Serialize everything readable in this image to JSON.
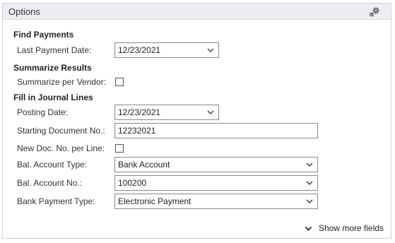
{
  "panel": {
    "title": "Options",
    "gear_icon": "gears-icon"
  },
  "sections": {
    "find_payments": "Find Payments",
    "summarize_results": "Summarize Results",
    "fill_journal": "Fill in Journal Lines"
  },
  "fields": {
    "last_payment_date": {
      "label": "Last Payment Date:",
      "value": "12/23/2021"
    },
    "summarize_per_vendor": {
      "label": "Summarize per Vendor:",
      "checked": false
    },
    "posting_date": {
      "label": "Posting Date:",
      "value": "12/23/2021"
    },
    "starting_doc_no": {
      "label": "Starting Document No.:",
      "value": "12232021"
    },
    "new_doc_per_line": {
      "label": "New Doc. No. per Line:",
      "checked": false
    },
    "bal_account_type": {
      "label": "Bal. Account Type:",
      "value": "Bank Account"
    },
    "bal_account_no": {
      "label": "Bal. Account No.:",
      "value": "100200"
    },
    "bank_payment_type": {
      "label": "Bank Payment Type:",
      "value": "Electronic Payment"
    }
  },
  "footer": {
    "show_more_label": "Show more fields"
  }
}
